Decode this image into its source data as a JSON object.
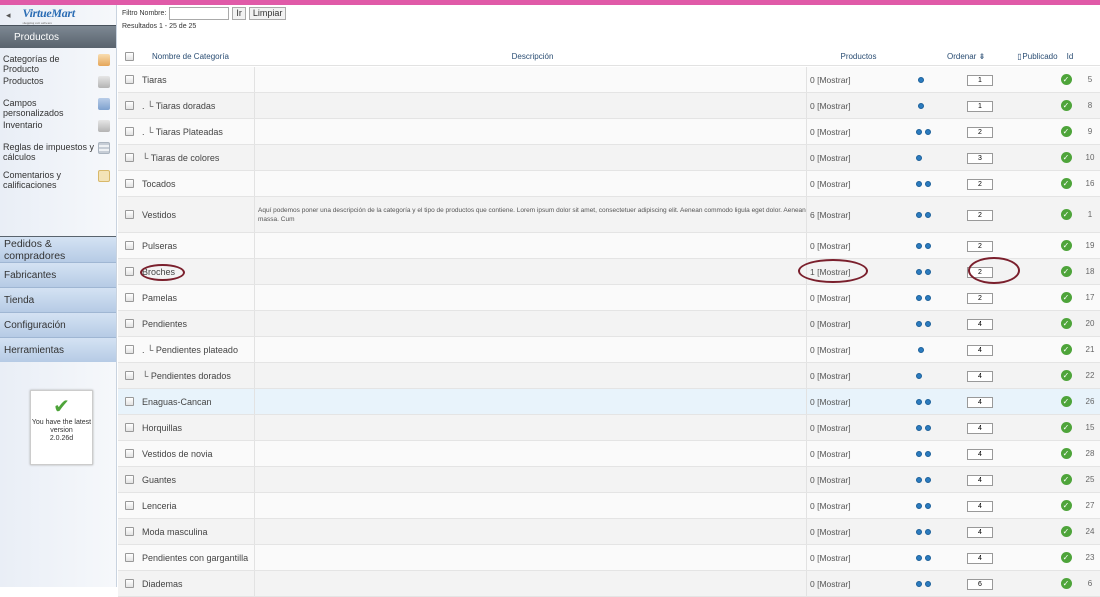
{
  "sidebar": {
    "brand": "VirtueMart",
    "brand_tagline": "shopping cart software",
    "active_section": "Productos",
    "items": [
      {
        "label": "Categorías de Producto",
        "icon": "category-icon"
      },
      {
        "label": "Productos",
        "icon": "products-icon"
      },
      {
        "label": "Campos personalizados",
        "icon": "custom-fields-icon"
      },
      {
        "label": "Inventario",
        "icon": "inventory-icon"
      },
      {
        "label": "Reglas de impuestos y cálculos",
        "icon": "tax-rules-icon"
      },
      {
        "label": "Comentarios y calificaciones",
        "icon": "reviews-icon"
      }
    ],
    "sections": [
      "Pedidos & compradores",
      "Fabricantes",
      "Tienda",
      "Configuración",
      "Herramientas"
    ],
    "version": {
      "line1": "You have the latest",
      "line2": "version",
      "line3": "2.0.26d"
    }
  },
  "filter": {
    "label": "Filtro Nombre:",
    "value": "",
    "go_label": "Ir",
    "reset_label": "Limpiar"
  },
  "results_text": "Resultados 1 - 25 de 25",
  "columns": {
    "name": "Nombre de Categoría",
    "description": "Descripción",
    "products": "Productos",
    "order": "Ordenar",
    "published": "Publicado",
    "id": "Id"
  },
  "rows": [
    {
      "name": "Tiaras",
      "desc": "",
      "products": "0 [Mostrar]",
      "arrows": [
        "down"
      ],
      "order": "1",
      "id": "5"
    },
    {
      "name": ". └ Tiaras doradas",
      "desc": "",
      "products": "0 [Mostrar]",
      "arrows": [
        "down"
      ],
      "order": "1",
      "id": "8"
    },
    {
      "name": ". └ Tiaras Plateadas",
      "desc": "",
      "products": "0 [Mostrar]",
      "arrows": [
        "up",
        "down"
      ],
      "order": "2",
      "id": "9"
    },
    {
      "name": "└ Tiaras de colores",
      "desc": "",
      "products": "0 [Mostrar]",
      "arrows": [
        "up"
      ],
      "order": "3",
      "id": "10"
    },
    {
      "name": "Tocados",
      "desc": "",
      "products": "0 [Mostrar]",
      "arrows": [
        "up",
        "down"
      ],
      "order": "2",
      "id": "16"
    },
    {
      "name": "Vestidos",
      "desc": "Aquí podemos poner una descripción de la categoría y el tipo de productos que contiene. Lorem ipsum dolor sit amet, consectetuer adipiscing elit. Aenean commodo ligula eget dolor. Aenean massa. Cum",
      "products": "6 [Mostrar]",
      "arrows": [
        "up",
        "down"
      ],
      "order": "2",
      "id": "1"
    },
    {
      "name": "Pulseras",
      "desc": "",
      "products": "0 [Mostrar]",
      "arrows": [
        "up",
        "down"
      ],
      "order": "2",
      "id": "19"
    },
    {
      "name": "Broches",
      "desc": "",
      "products": "1 [Mostrar]",
      "arrows": [
        "up",
        "down"
      ],
      "order": "2",
      "id": "18"
    },
    {
      "name": "Pamelas",
      "desc": "",
      "products": "0 [Mostrar]",
      "arrows": [
        "up",
        "down"
      ],
      "order": "2",
      "id": "17"
    },
    {
      "name": "Pendientes",
      "desc": "",
      "products": "0 [Mostrar]",
      "arrows": [
        "up",
        "down"
      ],
      "order": "4",
      "id": "20"
    },
    {
      "name": ". └ Pendientes plateado",
      "desc": "",
      "products": "0 [Mostrar]",
      "arrows": [
        "down"
      ],
      "order": "4",
      "id": "21"
    },
    {
      "name": "└ Pendientes dorados",
      "desc": "",
      "products": "0 [Mostrar]",
      "arrows": [
        "up"
      ],
      "order": "4",
      "id": "22"
    },
    {
      "name": "Enaguas-Cancan",
      "desc": "",
      "products": "0 [Mostrar]",
      "arrows": [
        "up",
        "down"
      ],
      "order": "4",
      "id": "26"
    },
    {
      "name": "Horquillas",
      "desc": "",
      "products": "0 [Mostrar]",
      "arrows": [
        "up",
        "down"
      ],
      "order": "4",
      "id": "15"
    },
    {
      "name": "Vestidos de novia",
      "desc": "",
      "products": "0 [Mostrar]",
      "arrows": [
        "up",
        "down"
      ],
      "order": "4",
      "id": "28"
    },
    {
      "name": "Guantes",
      "desc": "",
      "products": "0 [Mostrar]",
      "arrows": [
        "up",
        "down"
      ],
      "order": "4",
      "id": "25"
    },
    {
      "name": "Lenceria",
      "desc": "",
      "products": "0 [Mostrar]",
      "arrows": [
        "up",
        "down"
      ],
      "order": "4",
      "id": "27"
    },
    {
      "name": "Moda masculina",
      "desc": "",
      "products": "0 [Mostrar]",
      "arrows": [
        "up",
        "down"
      ],
      "order": "4",
      "id": "24"
    },
    {
      "name": "Pendientes con gargantilla",
      "desc": "",
      "products": "0 [Mostrar]",
      "arrows": [
        "up",
        "down"
      ],
      "order": "4",
      "id": "23"
    },
    {
      "name": "Diademas",
      "desc": "",
      "products": "0 [Mostrar]",
      "arrows": [
        "up",
        "down"
      ],
      "order": "6",
      "id": "6"
    }
  ],
  "highlighted_row": "Enaguas-Cancan",
  "annotated_row": "Broches",
  "colors": {
    "accent": "#2a6cb4",
    "top_bar": "#e05aa8",
    "published": "#4ea43a",
    "annotation": "#7a1f2c"
  }
}
